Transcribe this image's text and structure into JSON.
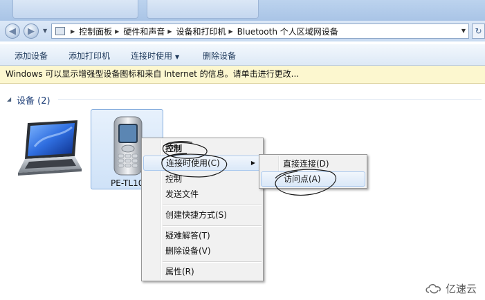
{
  "address_bar": {
    "crumbs": [
      "控制面板",
      "硬件和声音",
      "设备和打印机",
      "Bluetooth 个人区域网设备"
    ]
  },
  "toolbar": {
    "add_device": "添加设备",
    "add_printer": "添加打印机",
    "connect_using": "连接时使用",
    "remove_device": "删除设备"
  },
  "infobar": {
    "text": "Windows 可以显示增强型设备图标和来自 Internet 的信息。请单击进行更改..."
  },
  "devices_group": {
    "title": "设备 (2)",
    "phone_label": "PE-TL10"
  },
  "context_menu": {
    "items": [
      "控制",
      "连接时使用(C)",
      "控制",
      "发送文件",
      "创建快捷方式(S)",
      "疑难解答(T)",
      "删除设备(V)",
      "属性(R)"
    ]
  },
  "submenu": {
    "items": [
      "直接连接(D)",
      "访问点(A)"
    ]
  },
  "watermark": "亿速云",
  "colors": {
    "toolbar_text": "#1e395b",
    "infobar_bg": "#fcf7cf",
    "group_title": "#1e3f78",
    "highlight_border": "#a9c8ee"
  }
}
